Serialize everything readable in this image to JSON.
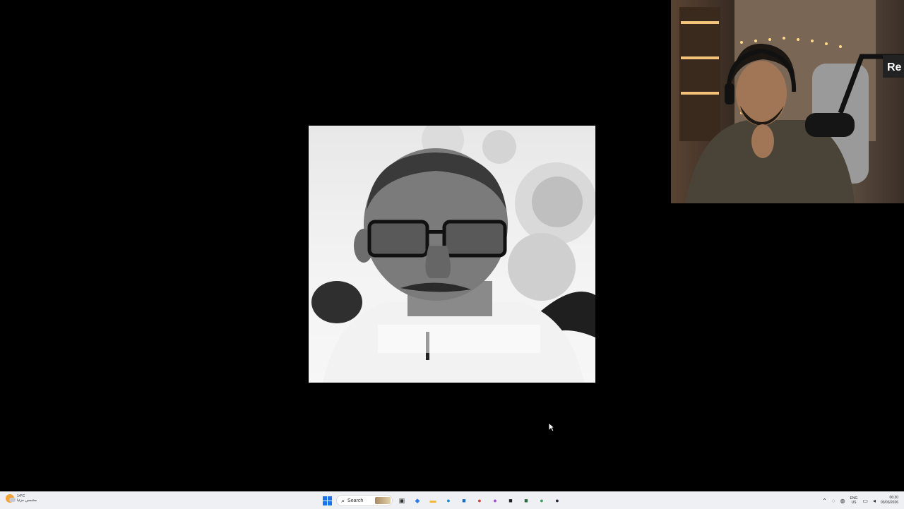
{
  "desktop": {
    "cursor_icon": "mouse-pointer-icon"
  },
  "main_video": {
    "caption_icon": "blurred-caption-overlay"
  },
  "webcam": {
    "badge_partial_text": "Re"
  },
  "taskbar": {
    "weather": {
      "temperature": "14°C",
      "condition": "مشمس جزئيا",
      "icon": "partly-sunny-icon"
    },
    "search_label": "Search",
    "apps": [
      {
        "name": "start-icon",
        "glyph": "",
        "color": "#1a73e8"
      },
      {
        "name": "task-view-icon",
        "glyph": "▣",
        "color": "#333333"
      },
      {
        "name": "copilot-icon",
        "glyph": "◆",
        "color": "#2b7de9"
      },
      {
        "name": "file-explorer-icon",
        "glyph": "▬",
        "color": "#f0b429"
      },
      {
        "name": "edge-icon",
        "glyph": "●",
        "color": "#0f8fd6"
      },
      {
        "name": "store-icon",
        "glyph": "■",
        "color": "#1570c9"
      },
      {
        "name": "chrome-red-icon",
        "glyph": "●",
        "color": "#d9443a"
      },
      {
        "name": "messenger-icon",
        "glyph": "●",
        "color": "#a14bd8"
      },
      {
        "name": "dark-app-icon",
        "glyph": "■",
        "color": "#1f1f1f"
      },
      {
        "name": "terminal-icon",
        "glyph": "■",
        "color": "#2a6b3f"
      },
      {
        "name": "chrome-icon",
        "glyph": "●",
        "color": "#3ba55c"
      },
      {
        "name": "steam-icon",
        "glyph": "●",
        "color": "#1b2838"
      }
    ],
    "tray": {
      "chevron_icon": "chevron-up-icon",
      "language_top": "ENG",
      "language_bottom": "US",
      "time": "06:30",
      "date": "03/03/2026"
    }
  }
}
